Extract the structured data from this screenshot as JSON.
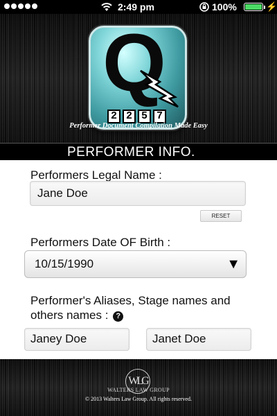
{
  "status_bar": {
    "time": "2:49 pm",
    "battery_percent": "100%",
    "battery_level": 1.0,
    "signal_dots": 5,
    "icons": [
      "signal-dots-icon",
      "wifi-icon",
      "rotation-lock-icon",
      "battery-icon",
      "charging-bolt-icon"
    ]
  },
  "header": {
    "logo_letter": "Q",
    "logo_counter": [
      "2",
      "2",
      "5",
      "7"
    ],
    "tagline": "Performer Document Compilation Made Easy"
  },
  "section": {
    "title": "PERFORMER INFO."
  },
  "form": {
    "legal_name_label": "Performers Legal Name :",
    "legal_name_value": "Jane Doe",
    "reset_label": "RESET",
    "dob_label": "Performers Date OF Birth :",
    "dob_value": "10/15/1990",
    "aliases_label_line1": "Performer's Aliases, Stage names and",
    "aliases_label_line2": "others names :",
    "help_glyph": "?",
    "aliases": [
      "Janey Doe",
      "Janet Doe"
    ]
  },
  "footer": {
    "logo_text": "WLG",
    "company": "WALTERS LAW GROUP",
    "copyright": "© 2013 Walters Law Group. All rights reserved."
  },
  "colors": {
    "battery_green": "#4cd964",
    "logo_teal": "#3e9aa0",
    "background_dark": "#161616"
  }
}
